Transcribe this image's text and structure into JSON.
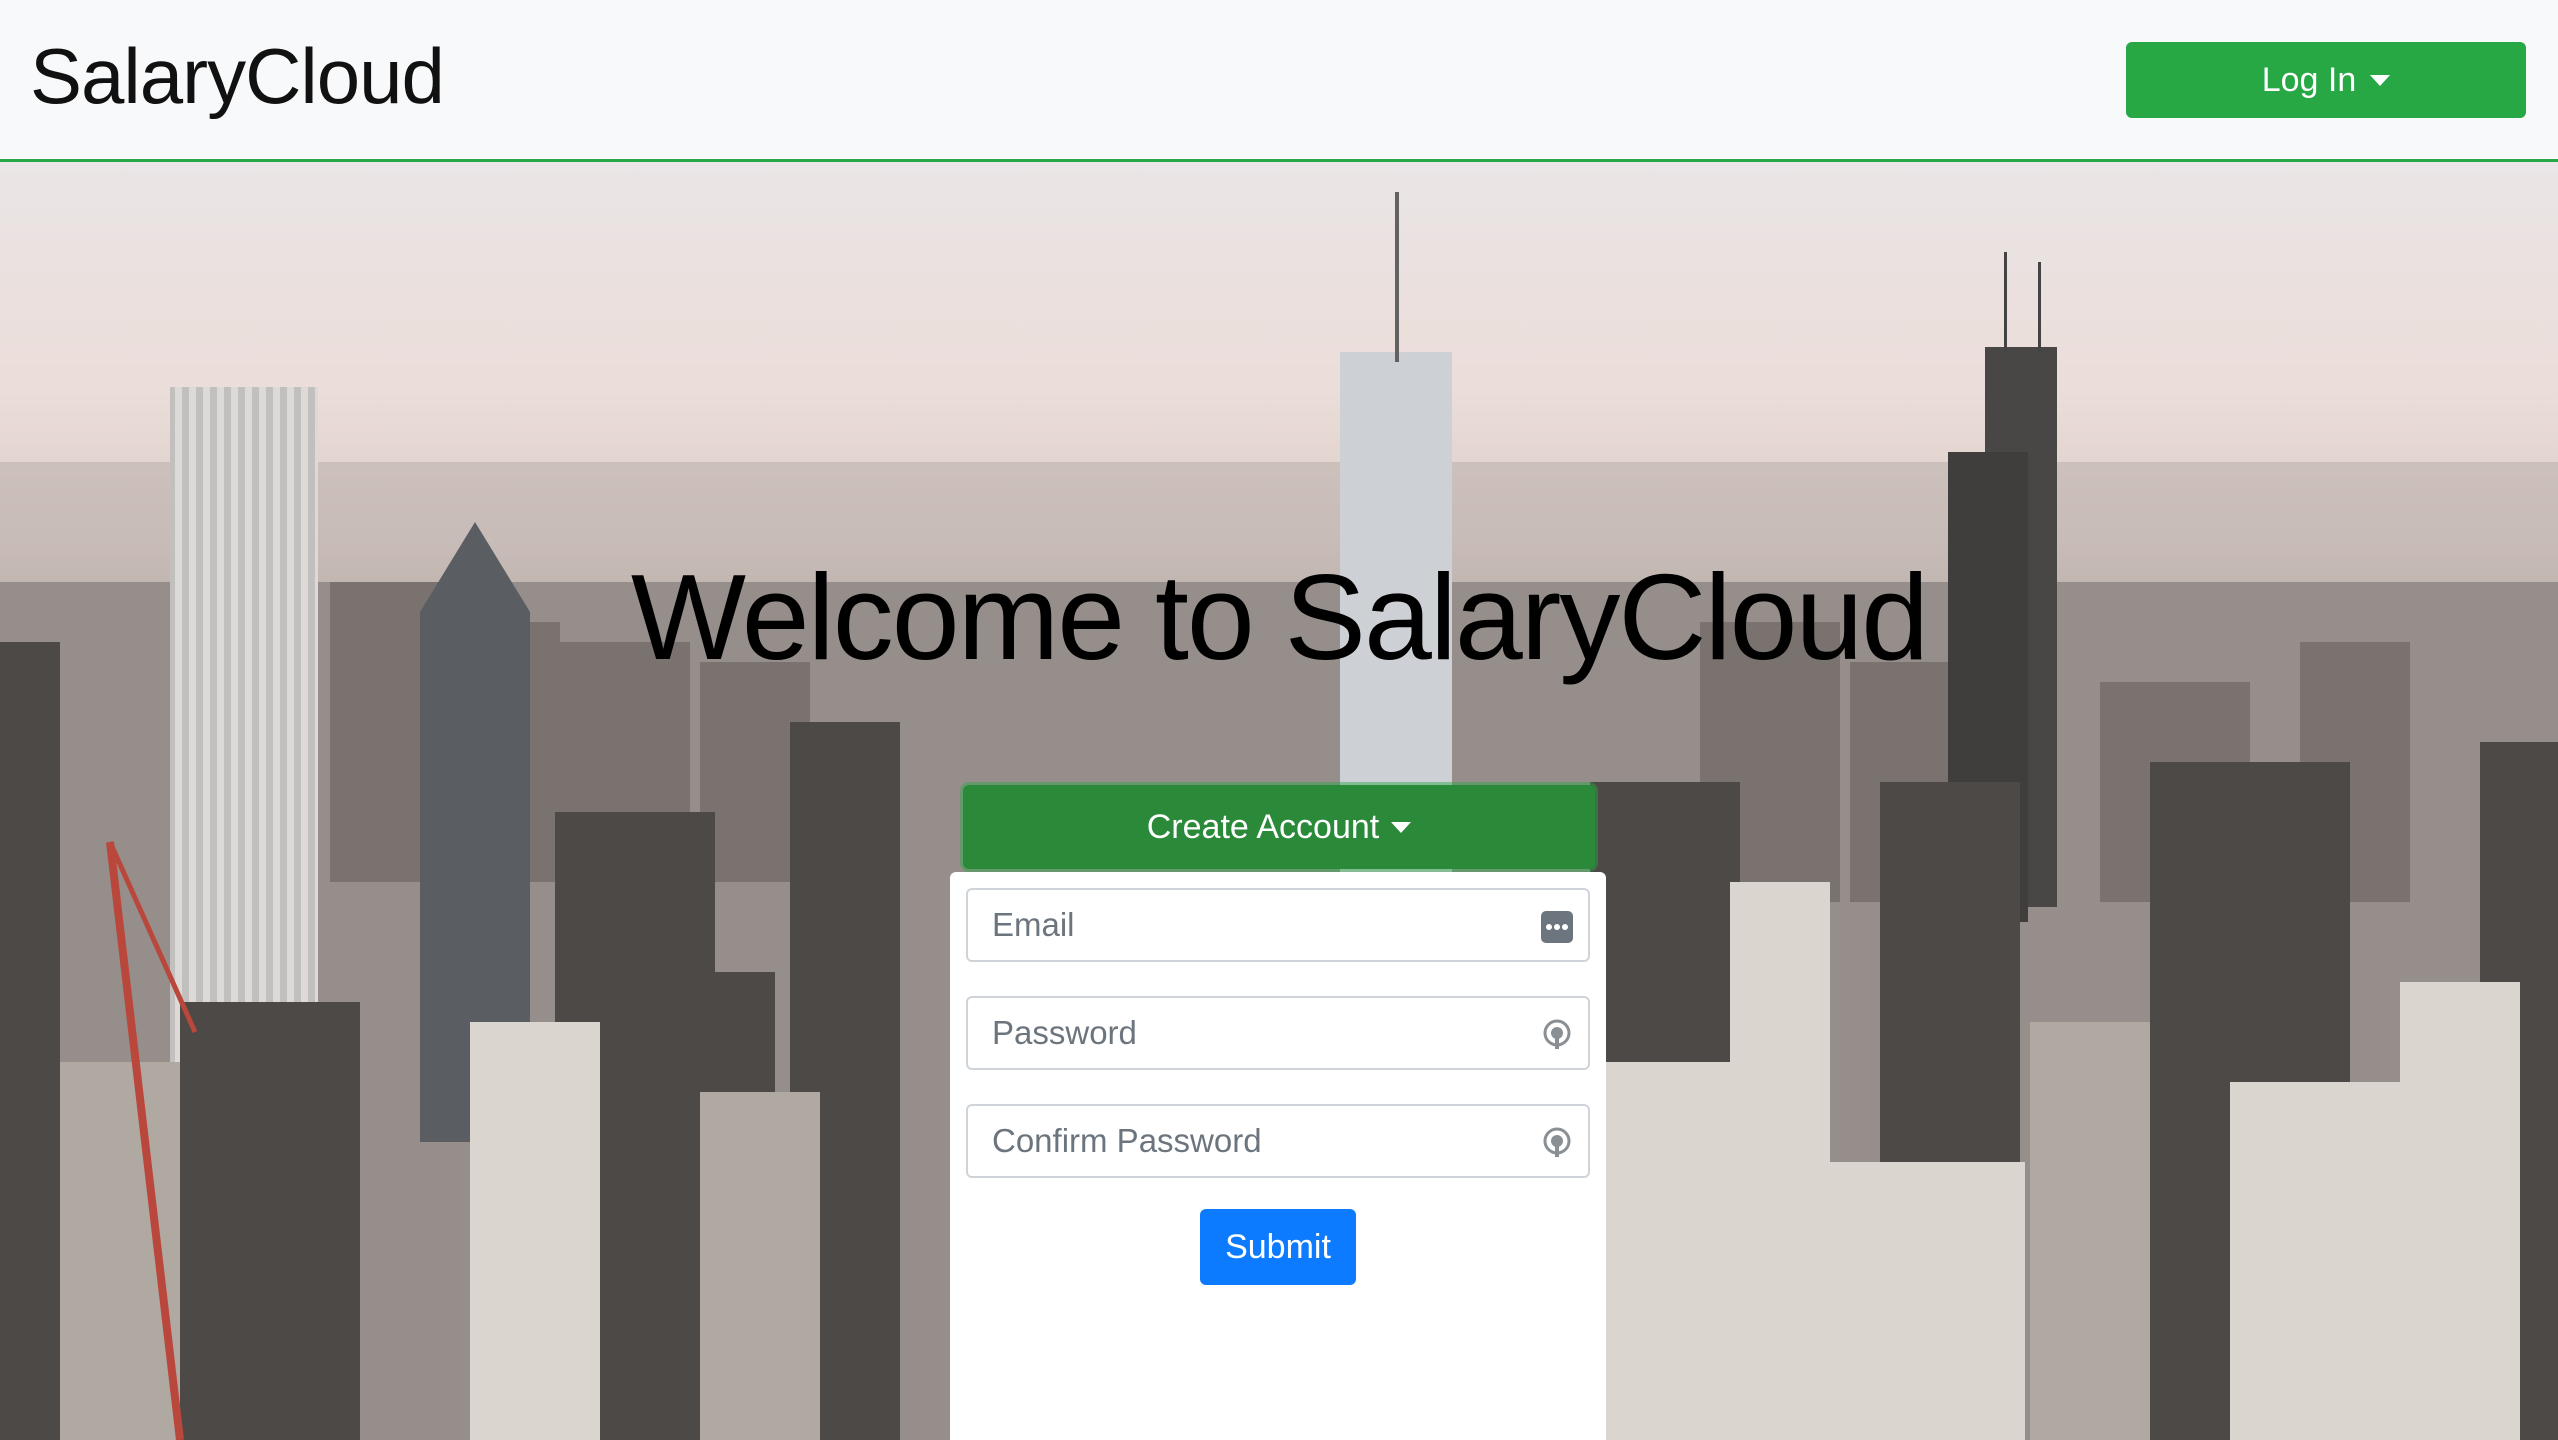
{
  "navbar": {
    "brand": "SalaryCloud",
    "login_label": "Log In"
  },
  "hero": {
    "title": "Welcome to SalaryCloud",
    "create_account_label": "Create Account"
  },
  "form": {
    "email_placeholder": "Email",
    "password_placeholder": "Password",
    "confirm_password_placeholder": "Confirm Password",
    "submit_label": "Submit"
  },
  "colors": {
    "brand_green": "#28a745",
    "primary_blue": "#0d7bff"
  },
  "icons": {
    "login_caret": "caret-down-icon",
    "create_caret": "caret-down-icon",
    "email_field_icon": "autofill-dots-icon",
    "password_field_icon": "password-key-icon"
  }
}
